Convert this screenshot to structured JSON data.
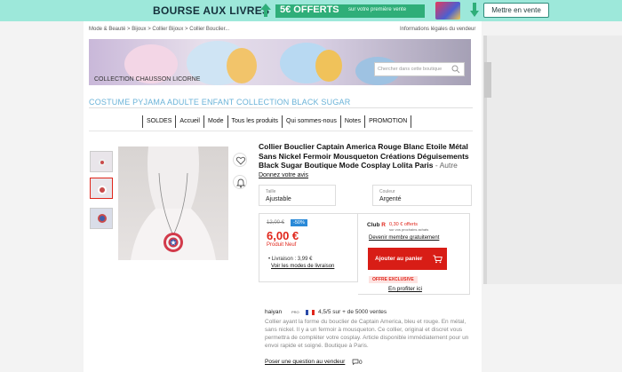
{
  "banner": {
    "title": "BOURSE AUX LIVRES",
    "offer_big": "5€ OFFERTS",
    "offer_small": "sur votre première vente",
    "button": "Mettre en vente"
  },
  "breadcrumb": "Mode & Beauté > Bijoux > Collier Bijoux > Collier Bouclier...",
  "legal_link": "Informations légales du vendeur",
  "store": {
    "collection_name": "COLLECTION CHAUSSON LICORNE",
    "search_placeholder": "Chercher dans cette boutique",
    "title": "COSTUME PYJAMA ADULTE ENFANT COLLECTION BLACK SUGAR",
    "nav": [
      "SOLDES",
      "Accueil",
      "Mode",
      "Tous les produits",
      "Qui sommes-nous",
      "Notes",
      "PROMOTION"
    ]
  },
  "product": {
    "title": "Collier Bouclier Captain America Rouge Blanc Etoile Métal Sans Nickel Fermoir Mousqueton Créations Déguisements Black Sugar Boutique Mode Cosplay Lolita Paris",
    "brand": " - Autre",
    "review_link": "Donnez votre avis",
    "option1_label": "Taille",
    "option1_value": "Ajustable",
    "option2_label": "Couleur",
    "option2_value": "Argenté"
  },
  "price": {
    "old": "12,00 €",
    "discount": "-50%",
    "current": "6,00 €",
    "condition": "Produit Neuf",
    "shipping": "• Livraison : 3,99 €",
    "shipping_link": "Voir les modes de livraison"
  },
  "club": {
    "logo_text": "Club",
    "logo_r": "R",
    "offer": "0,30 € offerts",
    "offer_sub": "sur vos prochains achats",
    "link": "Devenir membre gratuitement",
    "cart_button": "Ajouter au panier",
    "exclusive": "OFFRE EXCLUSIVE",
    "exclusive_link": "En profiter ici"
  },
  "seller": {
    "name": "haiyan",
    "badge": "PRO",
    "rating": "4,5/5 sur + de 5000 ventes",
    "description": "Collier ayant la forme du bouclier de Captain America, bleu et rouge. En métal, sans nickel. Il y a un fermoir à mousqueton. Ce collier, original et discret vous permettra de compléter votre cosplay. Article disponible immédiatement pour un envoi rapide et soigné. Boutique à Paris.",
    "ask_link": "Poser une question au vendeur",
    "question_count": "0"
  },
  "colors": {
    "banner_bg": "#9de8da",
    "price_red": "#e0261b",
    "store_title_blue": "#6bb3d8",
    "cart_red": "#d81d16"
  }
}
